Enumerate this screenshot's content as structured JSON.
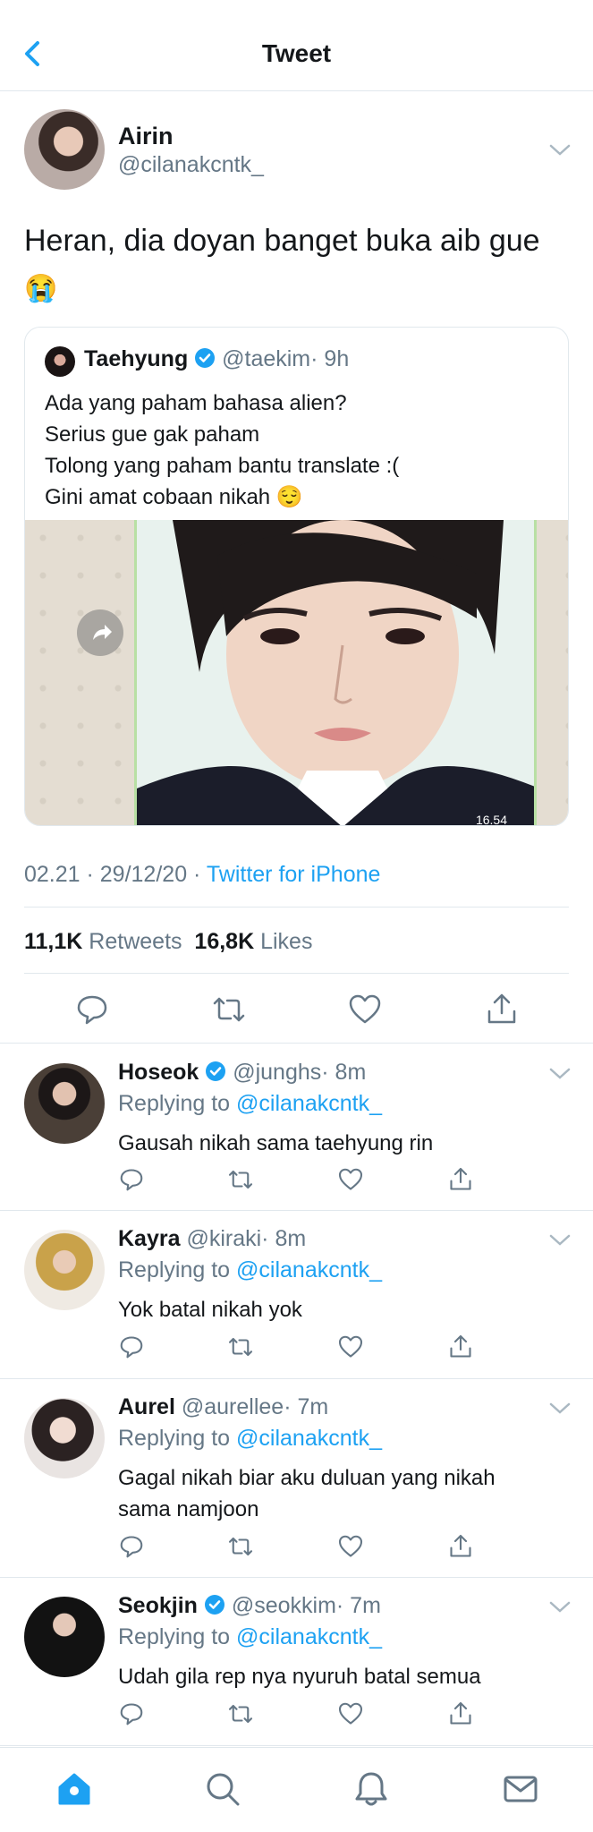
{
  "header": {
    "title": "Tweet"
  },
  "main_tweet": {
    "name": "Airin",
    "handle": "@cilanakcntk_",
    "text": "Heran, dia doyan banget buka aib gue",
    "emoji": "😭",
    "timestamp": "02.21 · 29/12/20 ·",
    "source": "Twitter for iPhone",
    "retweets_count": "11,1K",
    "retweets_label": "Retweets",
    "likes_count": "16,8K",
    "likes_label": "Likes"
  },
  "quoted_tweet": {
    "name": "Taehyung",
    "handle": "@taekim",
    "time": "· 9h",
    "lines": [
      "Ada yang paham bahasa alien?",
      "Serius gue gak paham",
      "Tolong yang paham bantu translate :(",
      "Gini amat cobaan nikah 😌"
    ],
    "image_timestamp": "16.54"
  },
  "replies": [
    {
      "name": "Hoseok",
      "verified": true,
      "handle": "@junghs",
      "time": "· 8m",
      "replying_label": "Replying to",
      "replying_to": "@cilanakcntk_",
      "text": [
        "Gausah nikah sama taehyung rin"
      ]
    },
    {
      "name": "Kayra",
      "verified": false,
      "handle": "@kiraki",
      "time": "· 8m",
      "replying_label": "Replying to",
      "replying_to": "@cilanakcntk_",
      "text": [
        "Yok batal nikah yok"
      ]
    },
    {
      "name": "Aurel",
      "verified": false,
      "handle": "@aurellee",
      "time": "· 7m",
      "replying_label": "Replying to",
      "replying_to": "@cilanakcntk_",
      "text": [
        "Gagal nikah biar aku duluan yang nikah",
        "sama namjoon"
      ]
    },
    {
      "name": "Seokjin",
      "verified": true,
      "handle": "@seokkim",
      "time": "· 7m",
      "replying_label": "Replying to",
      "replying_to": "@cilanakcntk_",
      "text": [
        "Udah gila rep nya nyuruh batal semua"
      ]
    }
  ],
  "bottom_nav": [
    "home-icon",
    "search-icon",
    "notifications-icon",
    "messages-icon"
  ],
  "colors": {
    "accent": "#1da1f2",
    "text": "#14171a",
    "secondary": "#657786",
    "divider": "#e1e8ed"
  }
}
